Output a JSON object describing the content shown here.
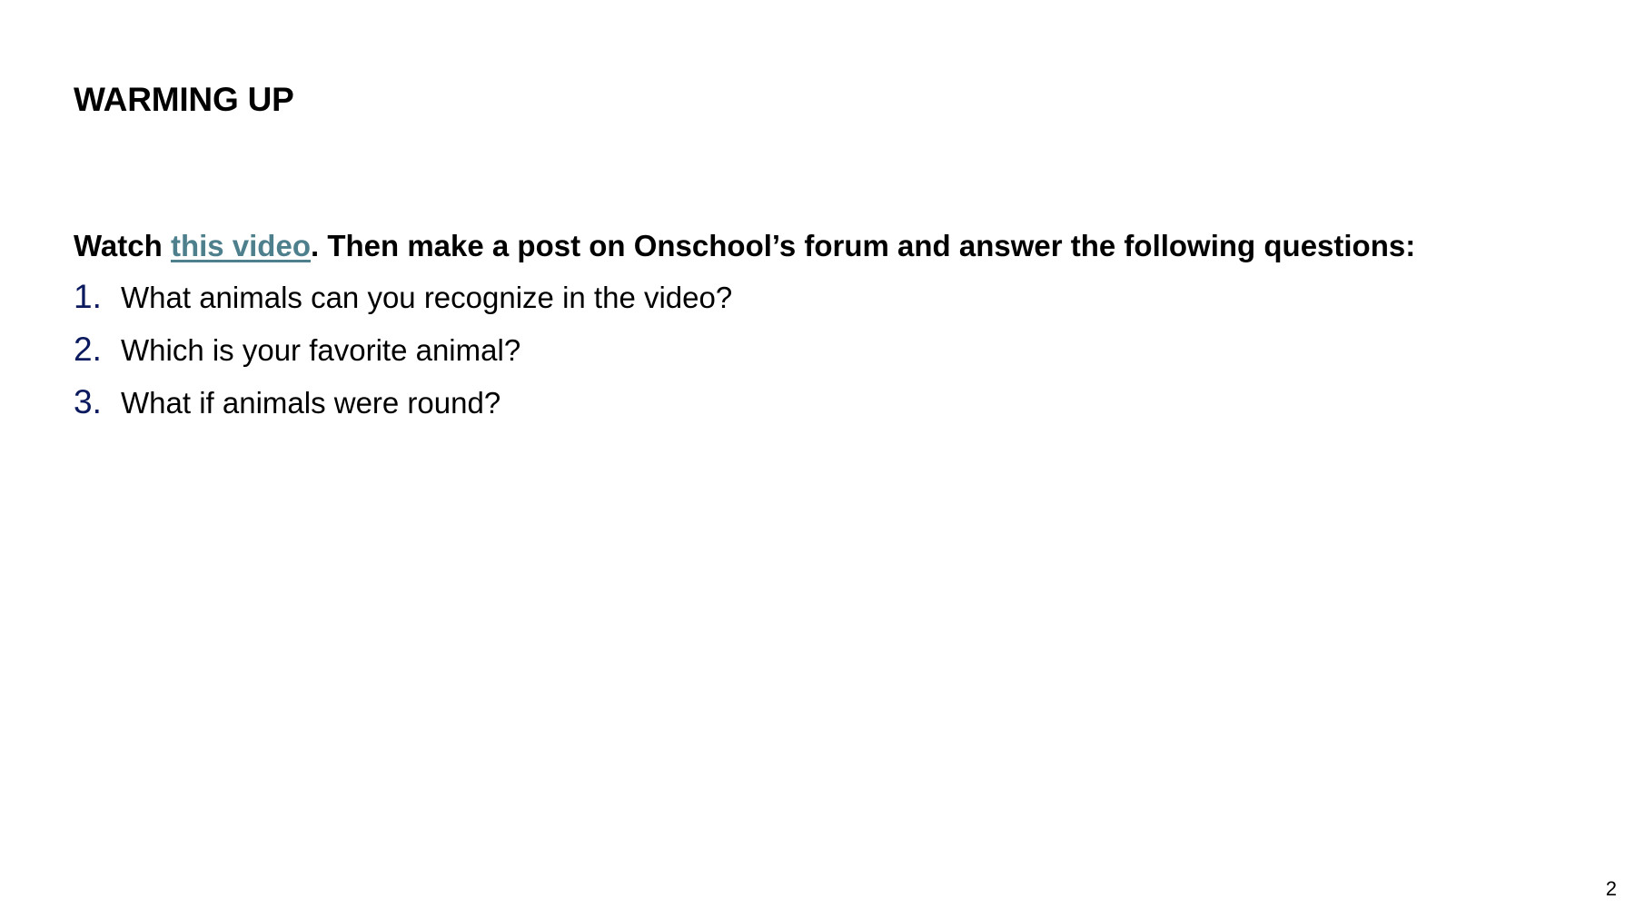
{
  "slide": {
    "title": "WARMING UP",
    "instructions": {
      "prefix": "Watch ",
      "link_text": "this video",
      "suffix": ". Then make a post on Onschool’s forum and answer the following questions:"
    },
    "questions": [
      {
        "number": "1.",
        "text": "What animals can you recognize in the video?"
      },
      {
        "number": "2.",
        "text": "Which is your favorite animal?"
      },
      {
        "number": "3.",
        "text": "What if animals were round?"
      }
    ],
    "page_number": "2"
  },
  "colors": {
    "link": "#4e7f8c",
    "list_number": "#0b1a5e",
    "text": "#000000",
    "background": "#ffffff"
  }
}
